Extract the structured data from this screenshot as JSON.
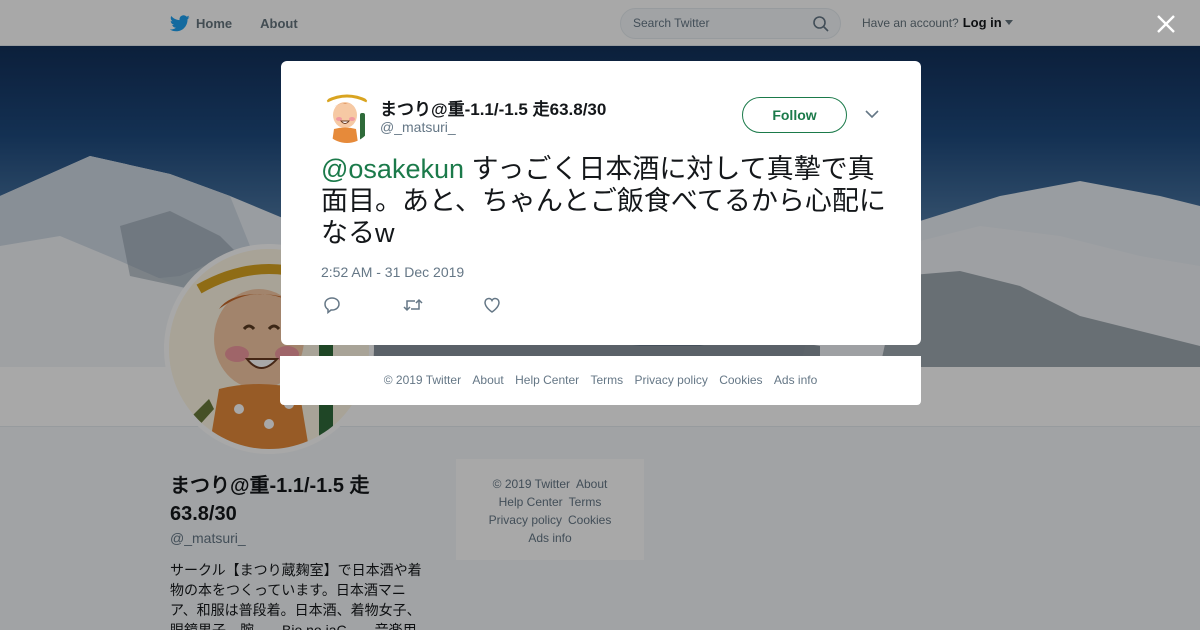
{
  "nav": {
    "home_label": "Home",
    "about_label": "About",
    "search_placeholder": "Search Twitter",
    "account_prompt": "Have an account?",
    "login_label": "Log in"
  },
  "profile": {
    "name": "まつり@重-1.1/-1.5 走63.8/30",
    "handle": "@_matsuri_",
    "bio": "サークル【まつり蔵麹室】で日本酒や着物の本をつくっています。日本酒マニア、和服は普段着。日本酒、着物女子、眼鏡男子、腕……Bio.no.jaC……音楽用"
  },
  "side_footer": {
    "copyright": "© 2019 Twitter",
    "about": "About",
    "help": "Help Center",
    "terms": "Terms",
    "privacy": "Privacy policy",
    "cookies": "Cookies",
    "ads": "Ads info"
  },
  "tweet": {
    "author_name": "まつり@重-1.1/-1.5 走63.8/30",
    "author_handle": "@_matsuri_",
    "follow_label": "Follow",
    "mention": "@osakekun",
    "text": " すっごく日本酒に対して真摯で真面目。あと、ちゃんとご飯食べてるから心配になるw",
    "timestamp": "2:52 AM - 31 Dec 2019"
  },
  "footer": {
    "copyright": "© 2019 Twitter",
    "about": "About",
    "help": "Help Center",
    "terms": "Terms",
    "privacy": "Privacy policy",
    "cookies": "Cookies",
    "ads": "Ads info"
  },
  "colors": {
    "twitter_blue": "#1da1f2",
    "accent_green": "#1b7a4a",
    "muted_text": "#657786"
  },
  "icons": [
    "twitter-bird-icon",
    "search-icon",
    "caret-down-icon",
    "close-icon",
    "chevron-down-icon",
    "reply-icon",
    "retweet-icon",
    "like-icon"
  ]
}
